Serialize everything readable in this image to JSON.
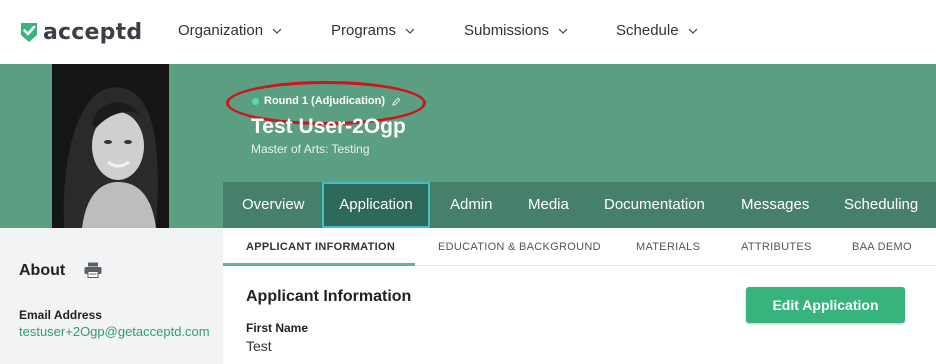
{
  "brand": {
    "name": "acceptd",
    "accent": "#37b37e",
    "header_green": "#5b9f82"
  },
  "topnav": {
    "items": [
      {
        "label": "Organization"
      },
      {
        "label": "Programs"
      },
      {
        "label": "Submissions"
      },
      {
        "label": "Schedule"
      }
    ]
  },
  "applicant": {
    "round_status": "Round 1 (Adjudication)",
    "name": "Test User-2Ogp",
    "program": "Master of Arts: Testing"
  },
  "tabs": [
    {
      "label": "Overview"
    },
    {
      "label": "Application",
      "active": true
    },
    {
      "label": "Admin"
    },
    {
      "label": "Media"
    },
    {
      "label": "Documentation"
    },
    {
      "label": "Messages"
    },
    {
      "label": "Scheduling"
    }
  ],
  "subtabs": [
    {
      "label": "APPLICANT INFORMATION",
      "active": true
    },
    {
      "label": "EDUCATION & BACKGROUND"
    },
    {
      "label": "MATERIALS"
    },
    {
      "label": "ATTRIBUTES"
    },
    {
      "label": "BAA DEMO"
    }
  ],
  "sidebar": {
    "title": "About",
    "email_label": "Email Address",
    "email_value": "testuser+2Ogp@getacceptd.com"
  },
  "main": {
    "section_title": "Applicant Information",
    "edit_button": "Edit Application",
    "fields": [
      {
        "label": "First Name",
        "value": "Test"
      }
    ]
  },
  "icons": {
    "logo": "check-mark-logo-icon",
    "chevron": "chevron-down-icon",
    "pencil": "pencil-icon",
    "printer": "printer-icon"
  }
}
